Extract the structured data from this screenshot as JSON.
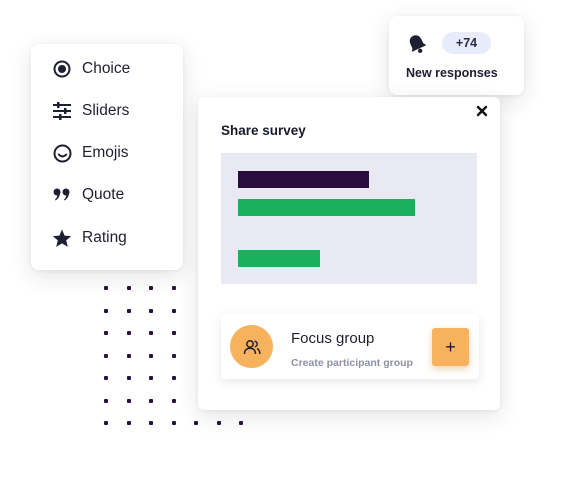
{
  "menu": {
    "items": [
      {
        "label": "Choice",
        "icon": "radio-icon"
      },
      {
        "label": "Sliders",
        "icon": "sliders-icon"
      },
      {
        "label": "Emojis",
        "icon": "smiley-icon"
      },
      {
        "label": "Quote",
        "icon": "quote-icon"
      },
      {
        "label": "Rating",
        "icon": "star-icon"
      }
    ]
  },
  "notification": {
    "count": "+74",
    "title": "New responses",
    "icon": "bell-icon"
  },
  "share": {
    "title": "Share survey",
    "close_icon": "close-icon",
    "preview_bars": [
      {
        "color": "#2a0d3f",
        "fill": 0.51
      },
      {
        "color": "#1ab05e",
        "fill": 0.69
      },
      {
        "color": "#1ab05e",
        "fill": 0.32
      }
    ],
    "focus_group": {
      "title": "Focus group",
      "subtitle": "Create participant group",
      "add_label": "+",
      "avatar_icon": "users-icon"
    }
  },
  "colors": {
    "accent": "#f6b25c",
    "dark": "#2a0d3f",
    "green": "#1ab05e",
    "preview_bg": "#e9e9f3"
  }
}
